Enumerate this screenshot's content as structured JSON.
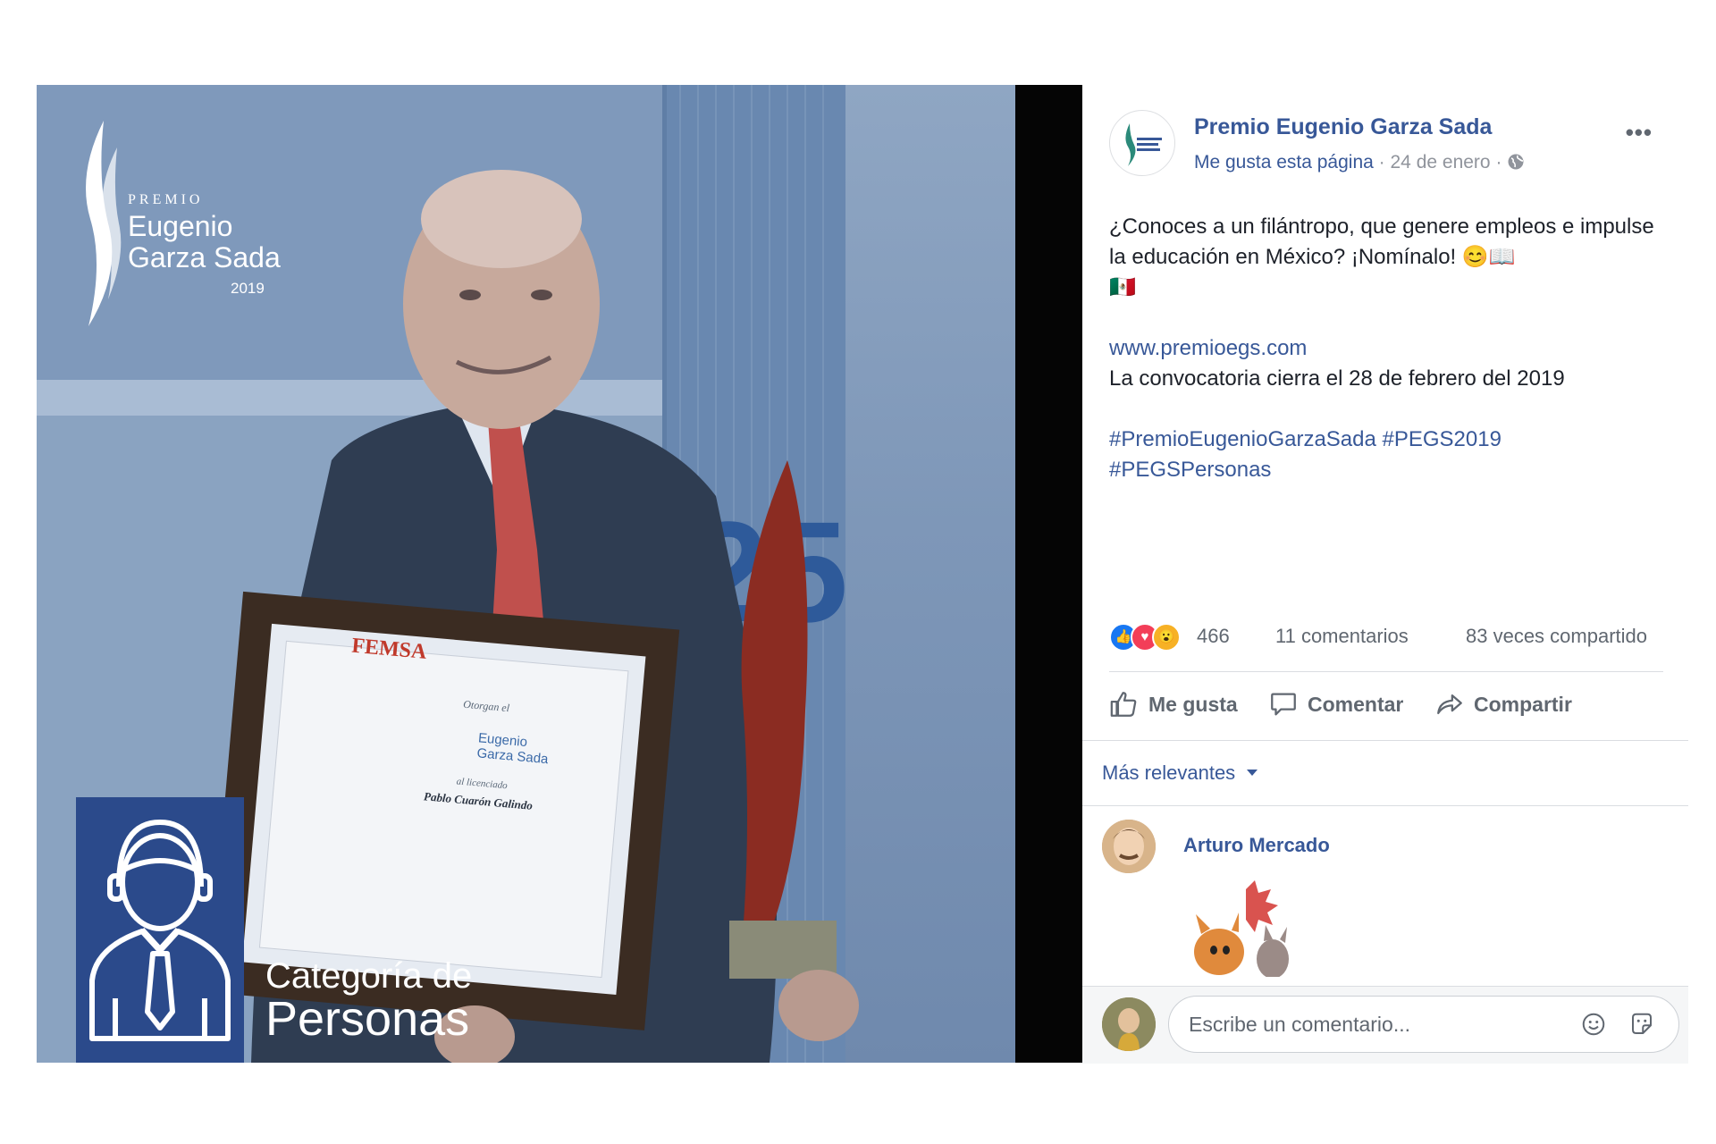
{
  "photo": {
    "logo": {
      "premio": "PREMIO",
      "line1": "Eugenio",
      "line2": "Garza Sada",
      "year": "2019"
    },
    "category": {
      "line1": "Categoría de",
      "line2": "Personas"
    },
    "diploma": {
      "brand": "FEMSA",
      "heading": "Otorgan el",
      "award_line1": "Eugenio",
      "award_line2": "Garza Sada",
      "recipient_label": "al licenciado",
      "recipient": "Pablo Cuarón Galindo"
    },
    "led_number": "25"
  },
  "post": {
    "page_name": "Premio Eugenio Garza Sada",
    "like_page": "Me gusta esta página",
    "date": "24 de enero",
    "separator": "·",
    "more": "•••",
    "text_line1": "¿Conoces a un filántropo, que genere empleos e impulse la educación en México? ¡Nomínalo! 😊📖",
    "text_flag": "🇲🇽",
    "link": "www.premioegs.com",
    "deadline": "La convocatoria cierra el 28 de febrero del 2019",
    "hashtags_line1": "#PremioEugenioGarzaSada #PEGS2019",
    "hashtags_line2": "#PEGSPersonas",
    "reactions_count": "466",
    "comments_count": "11 comentarios",
    "shares_count": "83 veces compartido",
    "actions": {
      "like": "Me gusta",
      "comment": "Comentar",
      "share": "Compartir"
    },
    "sort_label": "Más relevantes",
    "comment": {
      "author": "Arturo Mercado"
    },
    "comment_placeholder": "Escribe un comentario..."
  },
  "colors": {
    "link_blue": "#385898",
    "overlay_blue": "#2b4a8b",
    "like_blue": "#1877f2",
    "love_red": "#f33e58",
    "wow_yellow": "#f7b125"
  }
}
